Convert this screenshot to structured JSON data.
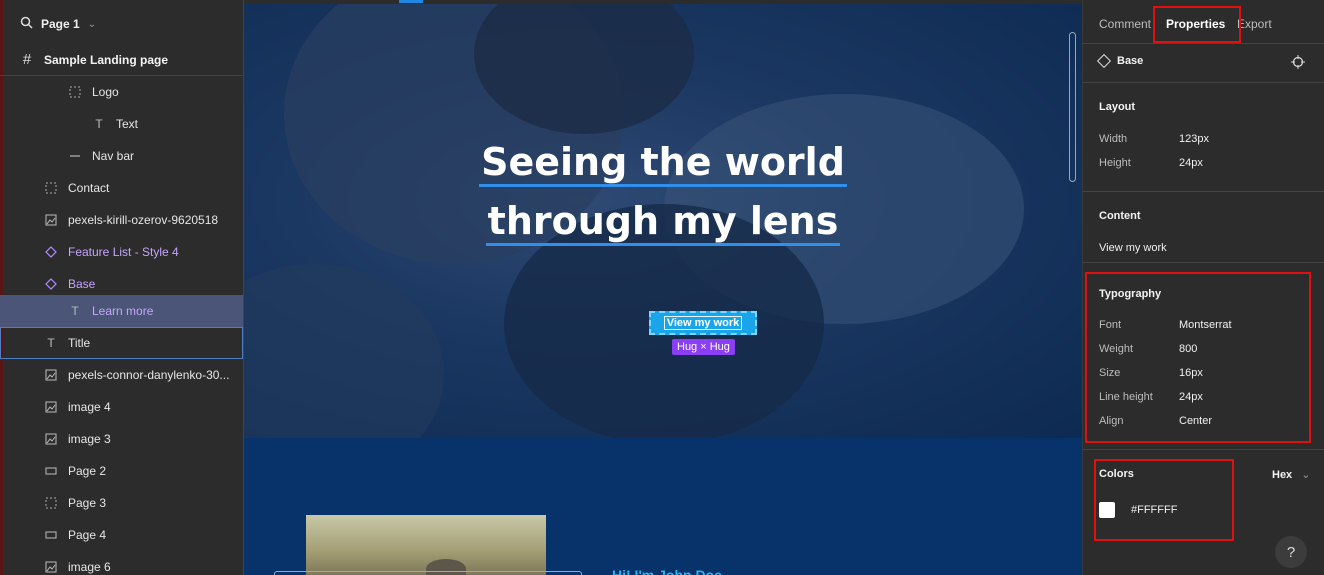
{
  "layers_panel": {
    "page_selector": {
      "label": "Page 1"
    },
    "frame": {
      "label": "Sample Landing page"
    },
    "items": [
      {
        "label": "Logo",
        "icon": "dashed-frame-icon"
      },
      {
        "label": "Text",
        "icon": "text-icon"
      },
      {
        "label": "Nav bar",
        "icon": "line-icon"
      },
      {
        "label": "Contact",
        "icon": "dashed-frame-icon"
      },
      {
        "label": "pexels-kirill-ozerov-9620518",
        "icon": "image-icon"
      },
      {
        "label": "Feature List - Style 4",
        "icon": "component-icon"
      },
      {
        "label": "Base",
        "icon": "component-icon"
      },
      {
        "label": "Learn more",
        "icon": "text-icon"
      },
      {
        "label": "Title",
        "icon": "text-icon"
      },
      {
        "label": "pexels-connor-danylenko-30...",
        "icon": "image-icon"
      },
      {
        "label": "image 4",
        "icon": "image-icon"
      },
      {
        "label": "image 3",
        "icon": "image-icon"
      },
      {
        "label": "Page 2",
        "icon": "rectangle-icon"
      },
      {
        "label": "Page 3",
        "icon": "dashed-frame-icon"
      },
      {
        "label": "Page 4",
        "icon": "rectangle-icon"
      },
      {
        "label": "image 6",
        "icon": "image-icon"
      }
    ]
  },
  "canvas": {
    "hero_title_line1": "Seeing the world",
    "hero_title_line2": "through my lens",
    "cta_label": "View my work",
    "hug_badge": "Hug × Hug",
    "greeting": "Hi! I'm John Doe"
  },
  "properties_panel": {
    "tabs": {
      "comment": "Comment",
      "properties": "Properties",
      "export": "Export"
    },
    "selection": {
      "name": "Base"
    },
    "layout": {
      "title": "Layout",
      "width_label": "Width",
      "width_value": "123px",
      "height_label": "Height",
      "height_value": "24px"
    },
    "content": {
      "title": "Content",
      "value": "View my work"
    },
    "typography": {
      "title": "Typography",
      "font_label": "Font",
      "font_value": "Montserrat",
      "weight_label": "Weight",
      "weight_value": "800",
      "size_label": "Size",
      "size_value": "16px",
      "line_height_label": "Line height",
      "line_height_value": "24px",
      "align_label": "Align",
      "align_value": "Center"
    },
    "colors": {
      "title": "Colors",
      "format": "Hex",
      "swatch_color": "#FFFFFF",
      "hex_value": "#FFFFFF"
    },
    "help": "?"
  },
  "theme": {
    "accent": "#1e88e5",
    "component_purple": "#c7a4ff",
    "highlight_red": "#e01010",
    "cta_blue": "#1aa5ea"
  }
}
